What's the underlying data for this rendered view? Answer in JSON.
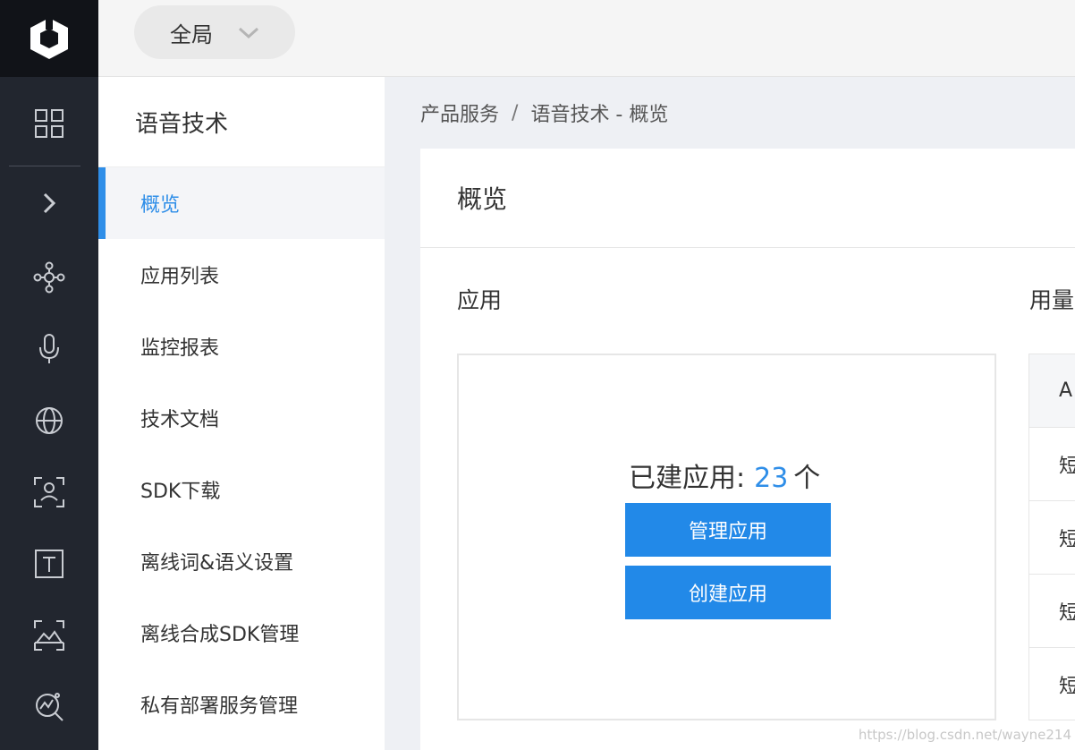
{
  "topbar": {
    "scope_label": "全局"
  },
  "rail": {
    "icons": [
      "logo-icon",
      "grid-icon",
      "chevron-right-icon",
      "network-icon",
      "microphone-icon",
      "globe-icon",
      "face-scan-icon",
      "text-icon",
      "image-scan-icon",
      "analytics-icon"
    ]
  },
  "subnav": {
    "title": "语音技术",
    "items": [
      {
        "label": "概览",
        "active": true
      },
      {
        "label": "应用列表"
      },
      {
        "label": "监控报表"
      },
      {
        "label": "技术文档"
      },
      {
        "label": "SDK下载"
      },
      {
        "label": "离线词&语义设置"
      },
      {
        "label": "离线合成SDK管理"
      },
      {
        "label": "私有部署服务管理"
      }
    ]
  },
  "breadcrumb": {
    "items": [
      "产品服务",
      "语音技术 - 概览"
    ],
    "separator": "/"
  },
  "main": {
    "title": "概览",
    "apps": {
      "section_title": "应用",
      "count_label": "已建应用:",
      "count": "23",
      "count_unit": "个",
      "manage_button": "管理应用",
      "create_button": "创建应用"
    },
    "usage": {
      "section_title": "用量",
      "rows": [
        "A",
        "短",
        "短",
        "短",
        "短"
      ]
    }
  },
  "watermark": "https://blog.csdn.net/wayne214",
  "colors": {
    "accent": "#2f8ee8",
    "button": "#2289e8",
    "rail_bg": "#22262f"
  }
}
